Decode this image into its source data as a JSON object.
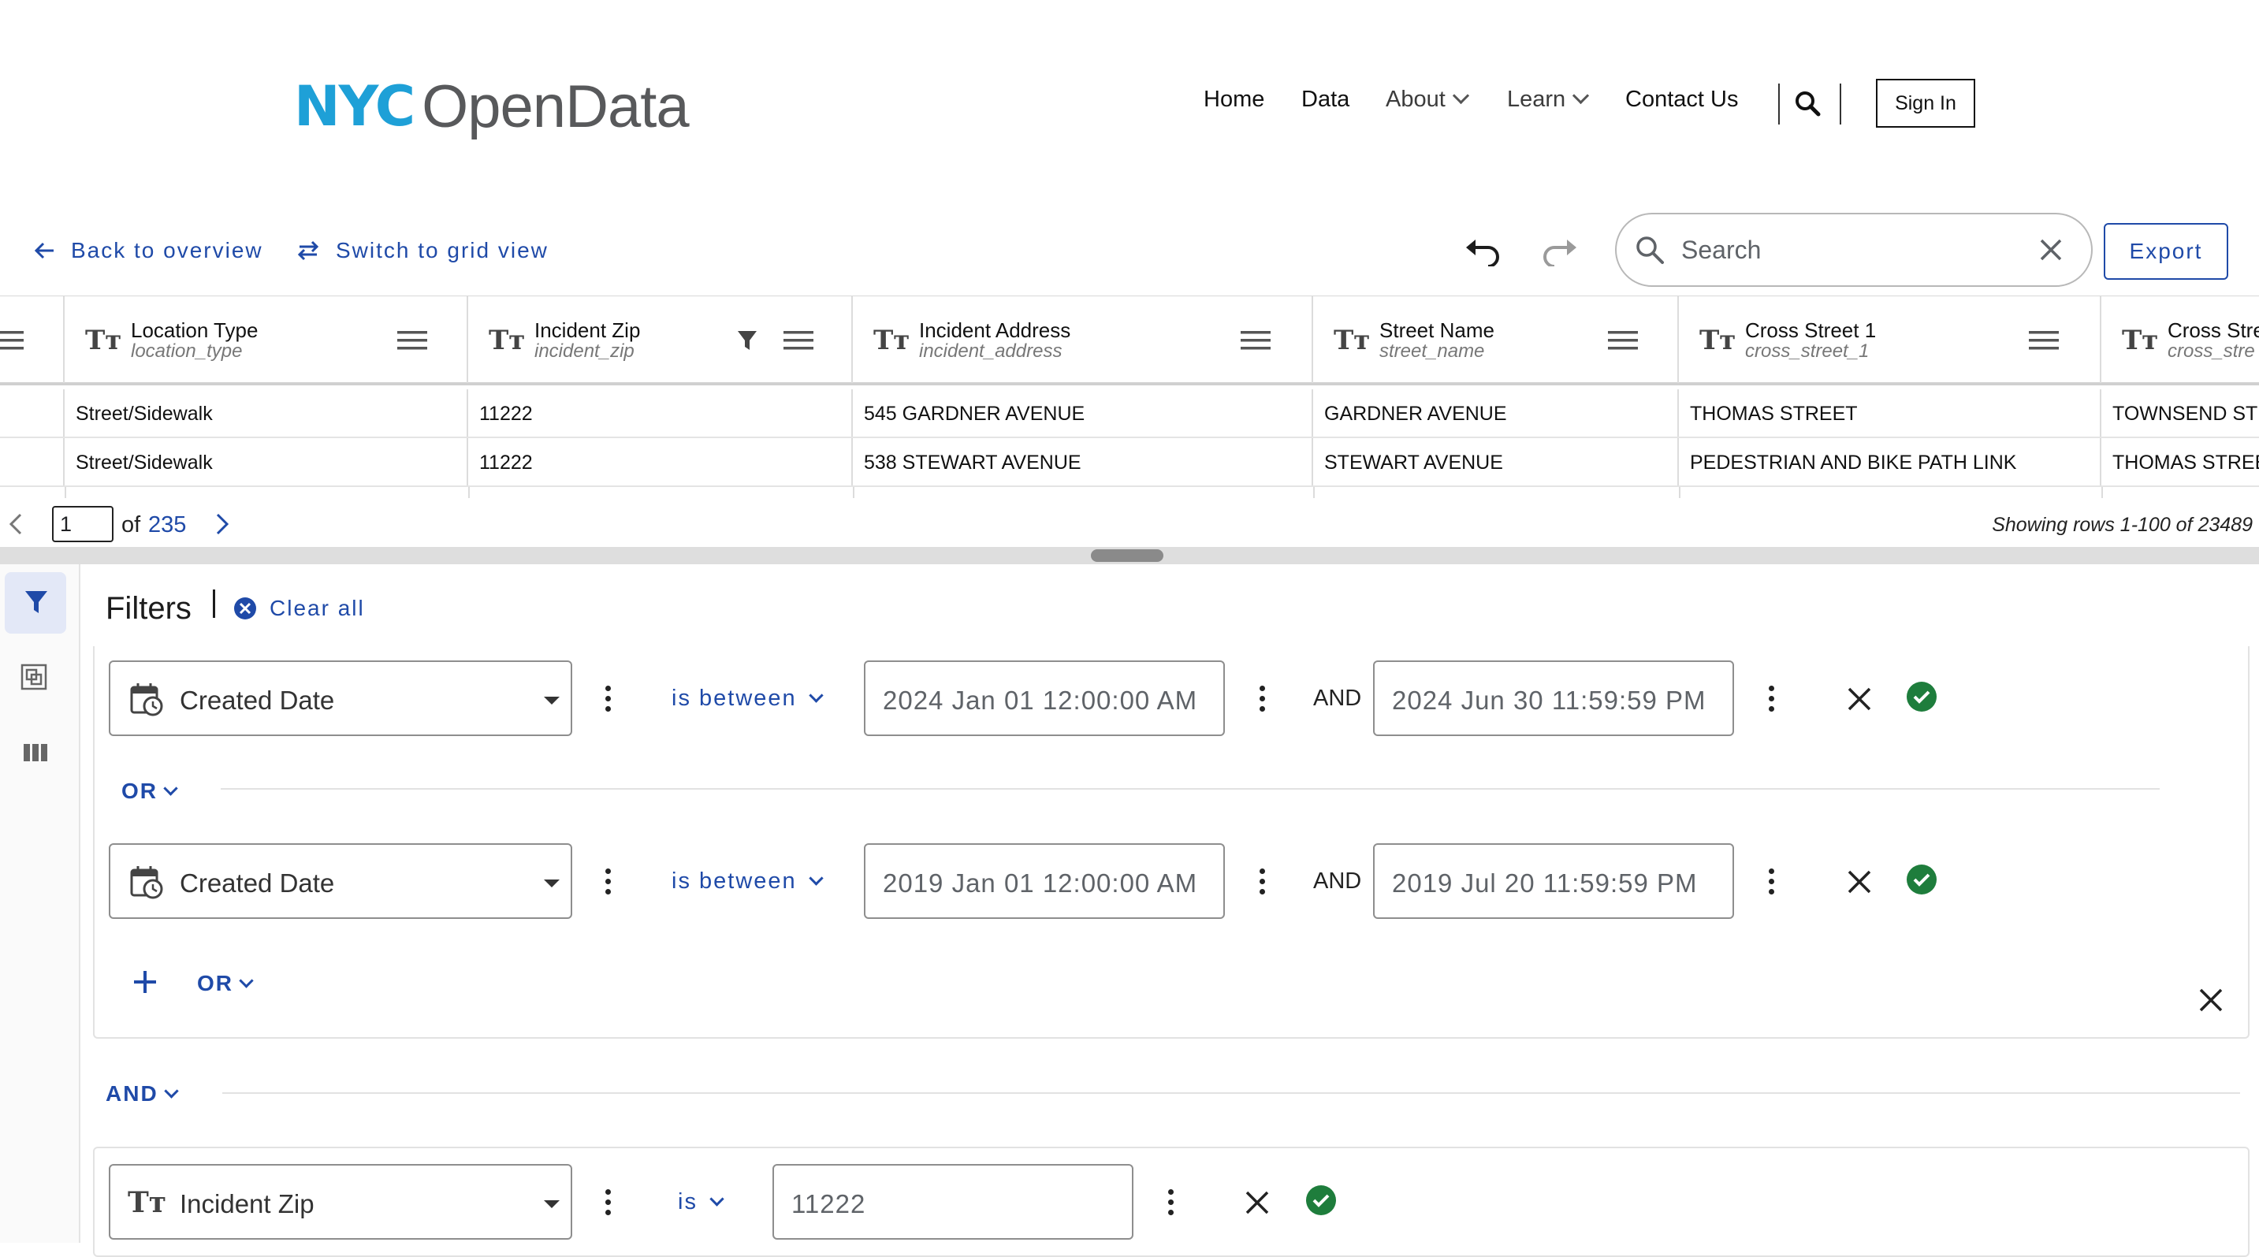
{
  "header": {
    "logo_nyc": "NYC",
    "logo_text": "OpenData",
    "nav": {
      "home": "Home",
      "data": "Data",
      "about": "About",
      "learn": "Learn",
      "contact": "Contact Us"
    },
    "signin": "Sign In"
  },
  "toolbar": {
    "back": "Back to overview",
    "switch": "Switch to grid view",
    "search_placeholder": "Search",
    "export": "Export"
  },
  "table": {
    "columns": [
      {
        "name": "Location Type",
        "field": "location_type"
      },
      {
        "name": "Incident Zip",
        "field": "incident_zip"
      },
      {
        "name": "Incident Address",
        "field": "incident_address"
      },
      {
        "name": "Street Name",
        "field": "street_name"
      },
      {
        "name": "Cross Street 1",
        "field": "cross_street_1"
      },
      {
        "name": "Cross Stre",
        "field": "cross_stre"
      }
    ],
    "rows": [
      [
        "Street/Sidewalk",
        "11222",
        "545 GARDNER AVENUE",
        "GARDNER AVENUE",
        "THOMAS STREET",
        "TOWNSEND STR"
      ],
      [
        "Street/Sidewalk",
        "11222",
        "538 STEWART AVENUE",
        "STEWART AVENUE",
        "PEDESTRIAN AND BIKE PATH LINK",
        "THOMAS STREE"
      ]
    ]
  },
  "pager": {
    "page": "1",
    "of": "of",
    "total": "235",
    "showing": "Showing rows 1-100 of 23489"
  },
  "filters": {
    "title": "Filters",
    "clear_all": "Clear all",
    "conditions": [
      {
        "column": "Created Date",
        "operator": "is between",
        "from": "2024 Jan 01 12:00:00 AM",
        "and": "AND",
        "to": "2024 Jun 30 11:59:59 PM"
      },
      {
        "column": "Created Date",
        "operator": "is between",
        "from": "2019 Jan 01 12:00:00 AM",
        "and": "AND",
        "to": "2019 Jul 20 11:59:59 PM"
      },
      {
        "column": "Incident Zip",
        "operator": "is",
        "value": "11222"
      }
    ],
    "or_label": "OR",
    "add_or_label": "OR",
    "and_label": "AND"
  },
  "icons": {
    "tt": "Tт"
  },
  "colors": {
    "brand_blue": "#1ea0d7",
    "link_blue": "#1f4aa8",
    "success_green": "#1e7d3c"
  }
}
